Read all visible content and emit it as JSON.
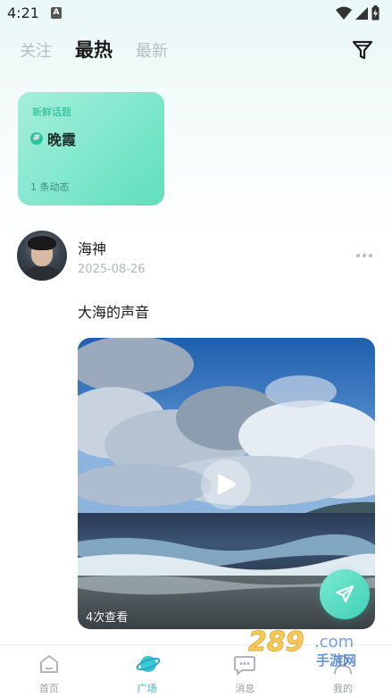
{
  "status_bar": {
    "time": "4:21",
    "notification_icon": "a-badge-icon",
    "icons": [
      "wifi-icon",
      "signal-icon",
      "battery-icon"
    ]
  },
  "top_tabs": [
    {
      "label": "关注",
      "active": false
    },
    {
      "label": "最热",
      "active": true
    },
    {
      "label": "最新",
      "active": false
    }
  ],
  "filter_icon": "filter-icon",
  "topic_card": {
    "tag": "新鲜话题",
    "hash": "#",
    "name": "晚霞",
    "count": "1 条动态"
  },
  "post": {
    "author": "海神",
    "date": "2025-08-26",
    "text": "大海的声音",
    "video": {
      "views": "4次查看"
    }
  },
  "bottom_nav": [
    {
      "label": "首页",
      "icon": "home-icon",
      "active": false
    },
    {
      "label": "广场",
      "icon": "planet-icon",
      "active": true
    },
    {
      "label": "消息",
      "icon": "chat-icon",
      "active": false
    },
    {
      "label": "我的",
      "icon": "profile-icon",
      "active": false
    }
  ],
  "watermark": {
    "text": "289.com",
    "subtext": "手游网"
  },
  "colors": {
    "accent": "#2cb9c6",
    "topic_card": "#7fe7cc",
    "fab": "#3fd1b4"
  }
}
